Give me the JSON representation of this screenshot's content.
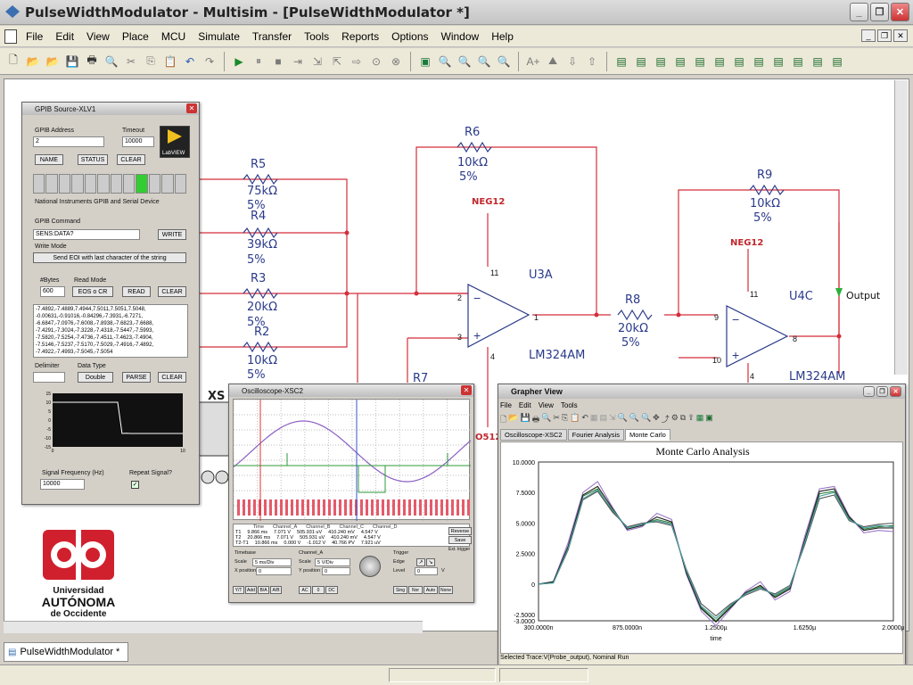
{
  "window": {
    "title": "PulseWidthModulator - Multisim - [PulseWidthModulator *]"
  },
  "menu": [
    "File",
    "Edit",
    "View",
    "Place",
    "MCU",
    "Simulate",
    "Transfer",
    "Tools",
    "Reports",
    "Options",
    "Window",
    "Help"
  ],
  "doc_tab": "PulseWidthModulator *",
  "schematic": {
    "resistors": [
      {
        "ref": "R5",
        "value": "75kΩ",
        "tol": "5%"
      },
      {
        "ref": "R4",
        "value": "39kΩ",
        "tol": "5%"
      },
      {
        "ref": "R3",
        "value": "20kΩ",
        "tol": "5%"
      },
      {
        "ref": "R2",
        "value": "10kΩ",
        "tol": "5%"
      },
      {
        "ref": "R6",
        "value": "10kΩ",
        "tol": "5%"
      },
      {
        "ref": "R8",
        "value": "20kΩ",
        "tol": "5%"
      },
      {
        "ref": "R9",
        "value": "10kΩ",
        "tol": "5%"
      },
      {
        "ref": "R7",
        "value": "",
        "tol": ""
      }
    ],
    "opamps": [
      {
        "ref": "U3A",
        "part": "LM324AM",
        "pins": [
          "2",
          "3",
          "11",
          "4",
          "1"
        ]
      },
      {
        "ref": "U4C",
        "part": "LM324AM",
        "pins": [
          "9",
          "10",
          "11",
          "4",
          "8"
        ]
      }
    ],
    "rails": [
      "NEG12",
      "NEG12"
    ],
    "probe": "Output",
    "instrument_label": "XS",
    "xsc_fragment": "O512"
  },
  "gpib": {
    "title": "GPIB Source-XLV1",
    "address_label": "GPIB Address",
    "address": "2",
    "timeout_label": "Timeout",
    "timeout": "10000",
    "logo": "LabVIEW",
    "name_btn": "NAME",
    "status_btn": "STATUS",
    "clear_btn": "CLEAR",
    "device_text": "National Instruments GPIB and Serial Device",
    "command_label": "GPIB Command",
    "command": "SENS:DATA?",
    "write_btn": "WRITE",
    "write_mode_label": "Write Mode",
    "write_mode": "Send EOI with last character of the string",
    "bytes_label": "#Bytes",
    "bytes": "600",
    "read_mode_label": "Read Mode",
    "read_mode": "EOS o CR",
    "read_btn": "READ",
    "clear2_btn": "CLEAR",
    "data_lines": [
      "-7.4892,-7.4889,7.4944,7.5011,7.5051,7.5048,",
      "-0.00631,-0.91016,-0.84296,-7.3931,-6.7271,",
      "-6.6847,-7.0976,-7.6008,-7.8938,-7.6823,-7.6688,",
      "-7.4291,-7.3024,-7.3228,-7.4318,-7.5447,-7.5993,",
      "-7.5820,-7.5254,-7.4736,-7.4511,-7.4623,-7.4904,",
      "-7.5146,-7.5237,-7.5170,-7.5029,-7.4916,-7.4892,",
      "-7.4922,-7.4993,-7.5045,-7.5054"
    ],
    "delimiter_label": "Delimiter",
    "data_type_label": "Data Type",
    "data_type": "Double",
    "parse_btn": "PARSE",
    "clear3_btn": "CLEAR",
    "graph_yticks": [
      "15",
      "10",
      "5",
      "0",
      "-5",
      "-10",
      "-15"
    ],
    "graph_xticks": [
      "0",
      "10"
    ],
    "freq_label": "Signal Frequency (Hz)",
    "freq": "10000",
    "repeat_label": "Repeat Signal?"
  },
  "scope": {
    "title": "Oscilloscope-XSC2",
    "readout_headers": [
      "Time",
      "Channel_A",
      "Channel_B",
      "Channel_C",
      "Channel_D"
    ],
    "readout_rows": [
      [
        "T1",
        "9.866 ms",
        "7.071 V",
        "505.931 uV",
        "410.240 mV",
        "4.547 V"
      ],
      [
        "T2",
        "20.866 ms",
        "7.071 V",
        "505.931 uV",
        "410.240 mV",
        "4.547 V"
      ],
      [
        "T2-T1",
        "10.866 ms",
        "0.000 V",
        "-1.012 V",
        "40.766 PV",
        "7.921 uV"
      ]
    ],
    "reverse_btn": "Reverse",
    "save_btn": "Save",
    "ext_trigger": "Ext. trigger",
    "timebase_label": "Timebase",
    "scale_label": "Scale",
    "timebase_scale": "5 ms/Div",
    "xpos_label": "X position",
    "xpos": "0",
    "channel_label": "Channel_A",
    "ch_scale": "5 V/Div",
    "ypos_label": "Y position",
    "ypos": "0",
    "trigger_label": "Trigger",
    "edge_label": "Edge",
    "level_label": "Level",
    "level": "0",
    "level_unit": "V",
    "mode_btns": [
      "Sing",
      "Nor",
      "Auto",
      "None"
    ],
    "coupling_btns": [
      "Y/T",
      "Add",
      "B/A",
      "A/B"
    ],
    "coupling_btns2": [
      "AC",
      "0",
      "DC"
    ]
  },
  "grapher": {
    "title": "Grapher View",
    "menu": [
      "File",
      "Edit",
      "View",
      "Tools"
    ],
    "tabs": [
      "Oscilloscope-XSC2",
      "Fourier Analysis",
      "Monte Carlo"
    ],
    "plot_title": "Monte Carlo Analysis",
    "xlabel": "time",
    "status": "Selected Trace:V(Probe_output), Nominal Run"
  },
  "logo": {
    "line1": "Universidad",
    "line2": "AUTÓNOMA",
    "line3": "de Occidente",
    "color": "#d0202e"
  },
  "chart_data": {
    "type": "line",
    "title": "Monte Carlo Analysis",
    "xlabel": "time",
    "ylabel": "",
    "x_ticks": [
      "300.0000n",
      "875.0000n",
      "1.2500µ",
      "1.6250µ",
      "2.0000µ"
    ],
    "y_ticks": [
      "10.0000",
      "7.5000",
      "5.0000",
      "2.5000",
      "0",
      "-2.5000",
      "-3.0000"
    ],
    "ylim": [
      -3.0,
      10.0
    ],
    "series": [
      {
        "color": "#2e7d32",
        "values": [
          0,
          0.2,
          3.0,
          7.2,
          7.8,
          6.0,
          4.6,
          4.9,
          5.3,
          5.0,
          1.0,
          -1.9,
          -3.0,
          -1.8,
          -0.8,
          -0.2,
          -1.0,
          -0.3,
          3.5,
          7.4,
          7.6,
          5.4,
          4.5,
          4.7,
          4.8
        ]
      },
      {
        "color": "#9a78c8",
        "values": [
          0,
          0.2,
          3.4,
          7.5,
          8.4,
          6.3,
          4.4,
          4.7,
          5.8,
          5.3,
          0.8,
          -2.2,
          -3.4,
          -2.0,
          -0.6,
          0.2,
          -1.3,
          -0.6,
          3.9,
          7.8,
          8.0,
          5.6,
          4.2,
          4.4,
          4.3
        ]
      },
      {
        "color": "#555555",
        "values": [
          0,
          0.1,
          2.8,
          6.9,
          7.6,
          5.9,
          4.7,
          5.0,
          5.1,
          4.8,
          1.2,
          -1.6,
          -2.6,
          -1.6,
          -0.9,
          -0.4,
          -0.8,
          -0.1,
          3.2,
          7.0,
          7.3,
          5.2,
          4.7,
          4.9,
          5.0
        ]
      },
      {
        "color": "#222222",
        "values": [
          0,
          0.2,
          3.1,
          7.3,
          8.0,
          6.2,
          4.5,
          4.8,
          5.5,
          5.1,
          0.9,
          -2.0,
          -3.1,
          -1.9,
          -0.7,
          -0.1,
          -1.1,
          -0.4,
          3.6,
          7.6,
          7.8,
          5.5,
          4.4,
          4.6,
          4.6
        ]
      },
      {
        "color": "#4aa0a0",
        "values": [
          0,
          0.1,
          2.9,
          7.0,
          7.7,
          6.1,
          4.6,
          4.9,
          5.2,
          4.9,
          1.1,
          -1.8,
          -2.8,
          -1.7,
          -0.8,
          -0.3,
          -0.9,
          -0.2,
          3.4,
          7.2,
          7.5,
          5.3,
          4.6,
          4.8,
          4.7
        ]
      }
    ]
  },
  "scope_chart": {
    "sine_color": "#8a5fc4",
    "square_color": "#2e9a3a",
    "pulse_color": "#e55a6a",
    "cursor1_color": "#d33",
    "cursor2_color": "#3355cc"
  },
  "gpib_chart": {
    "values": [
      10,
      10,
      10,
      10,
      10,
      10,
      10,
      10,
      10,
      10,
      10,
      10,
      10,
      10,
      10,
      10,
      -7.5,
      -7.4,
      -7.5,
      -7.5,
      -7.5,
      -7.5,
      -7.5,
      -7.5,
      -7.5,
      -7.5,
      -7.5,
      -7.5,
      -7.5,
      -7.5,
      -7.5
    ],
    "ylim": [
      -15,
      15
    ]
  }
}
